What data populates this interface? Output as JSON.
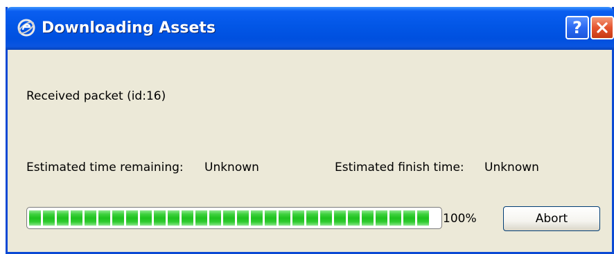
{
  "window": {
    "title": "Downloading Assets",
    "icon": "app-logo-icon",
    "help_label": "?",
    "close_icon": "close-icon"
  },
  "status": {
    "message": "Received packet (id:16)"
  },
  "estimates": {
    "remaining_label": "Estimated time remaining:",
    "remaining_value": "Unknown",
    "finish_label": "Estimated finish time:",
    "finish_value": "Unknown"
  },
  "progress": {
    "fraction": 1.0,
    "percent_text": "100%"
  },
  "actions": {
    "abort_label": "Abort"
  },
  "colors": {
    "titlebar": "#0054e3",
    "window_bg": "#ece9d8",
    "progress_fill": "#2fcb2f",
    "close_button": "#e5542e"
  }
}
